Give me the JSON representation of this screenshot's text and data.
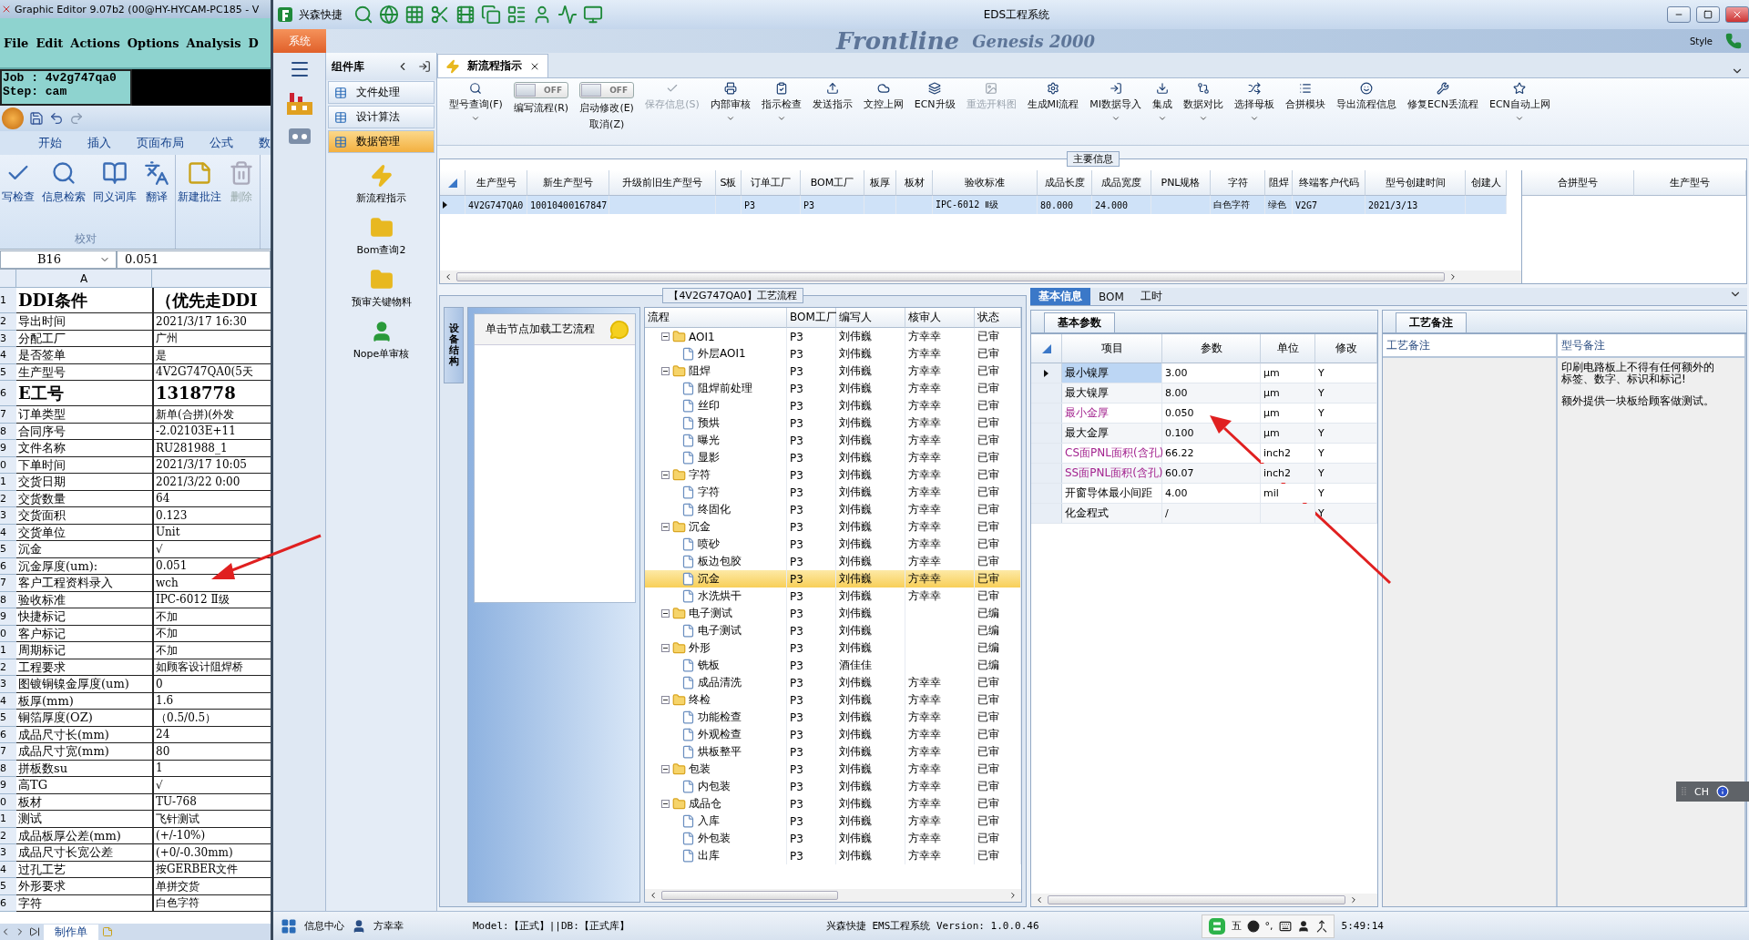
{
  "left_window": {
    "editor_title": "Graphic Editor 9.07b2 (00@HY-HYCAM-PC185 - V",
    "menu": [
      "File",
      "Edit",
      "Actions",
      "Options",
      "Analysis",
      "D"
    ],
    "job": "Job : 4v2g747qa0",
    "step": "Step: cam",
    "ribbon_tabs": [
      "开始",
      "插入",
      "页面布局",
      "公式",
      "数"
    ],
    "ribbon_buttons": [
      {
        "label": "写检查",
        "disabled": false
      },
      {
        "label": "信息检索",
        "disabled": false
      },
      {
        "label": "同义词库",
        "disabled": false
      },
      {
        "label": "翻译",
        "disabled": false
      },
      {
        "label": "新建批注",
        "disabled": false
      },
      {
        "label": "删除",
        "disabled": true
      }
    ],
    "ribbon_group": "校对",
    "name_box": "B16",
    "formula": "0.051",
    "column_a": "A",
    "rows": [
      {
        "num": "1",
        "a": "DDI条件",
        "b": "（优先走DDI",
        "kind": "heading"
      },
      {
        "num": "2",
        "a": "导出时间",
        "b": "2021/3/17 16:30",
        "kind": "normal"
      },
      {
        "num": "3",
        "a": "分配工厂",
        "b": "广州",
        "kind": "normal"
      },
      {
        "num": "4",
        "a": "是否签单",
        "b": "是",
        "kind": "normal"
      },
      {
        "num": "5",
        "a": "生产型号",
        "b": "4V2G747QA0(5天",
        "kind": "normal"
      },
      {
        "num": "6",
        "a": "E工号",
        "b": "1318778",
        "kind": "heading"
      },
      {
        "num": "7",
        "a": "订单类型",
        "b": "新单(合拼)(外发",
        "kind": "normal"
      },
      {
        "num": "8",
        "a": "合同序号",
        "b": "-2.02103E+11",
        "kind": "normal"
      },
      {
        "num": "9",
        "a": "文件名称",
        "b": "RU281988_1",
        "kind": "normal"
      },
      {
        "num": "0",
        "a": "下单时间",
        "b": "2021/3/17 10:05",
        "kind": "normal"
      },
      {
        "num": "1",
        "a": "交货日期",
        "b": "2021/3/22 0:00",
        "kind": "normal"
      },
      {
        "num": "2",
        "a": "交货数量",
        "b": "64",
        "kind": "normal"
      },
      {
        "num": "3",
        "a": "交货面积",
        "b": "0.123",
        "kind": "normal"
      },
      {
        "num": "4",
        "a": "交货单位",
        "b": "Unit",
        "kind": "normal"
      },
      {
        "num": "5",
        "a": "沉金",
        "b": "√",
        "kind": "normal"
      },
      {
        "num": "6",
        "a": "沉金厚度(um):",
        "b": "0.051",
        "kind": "normal"
      },
      {
        "num": "7",
        "a": "客户工程资料录入",
        "b": "wch",
        "kind": "normal"
      },
      {
        "num": "8",
        "a": "验收标准",
        "b": "IPC-6012 Ⅱ级",
        "kind": "normal"
      },
      {
        "num": "9",
        "a": "快捷标记",
        "b": "不加",
        "kind": "normal"
      },
      {
        "num": "0",
        "a": "客户标记",
        "b": "不加",
        "kind": "normal"
      },
      {
        "num": "1",
        "a": "周期标记",
        "b": "不加",
        "kind": "normal"
      },
      {
        "num": "2",
        "a": "工程要求",
        "b": "如顾客设计阻焊桥",
        "kind": "normal"
      },
      {
        "num": "3",
        "a": "图镀铜镍金厚度(um)",
        "b": "0",
        "kind": "normal"
      },
      {
        "num": "4",
        "a": "板厚(mm)",
        "b": "1.6",
        "kind": "normal"
      },
      {
        "num": "5",
        "a": "铜箔厚度(OZ)",
        "b": "（0.5/0.5）",
        "kind": "normal"
      },
      {
        "num": "6",
        "a": "成品尺寸长(mm)",
        "b": "24",
        "kind": "normal"
      },
      {
        "num": "7",
        "a": "成品尺寸宽(mm)",
        "b": "80",
        "kind": "normal"
      },
      {
        "num": "8",
        "a": "拼板数su",
        "b": "1",
        "kind": "normal"
      },
      {
        "num": "9",
        "a": "高TG",
        "b": "√",
        "kind": "normal"
      },
      {
        "num": "0",
        "a": "板材",
        "b": "TU-768",
        "kind": "normal"
      },
      {
        "num": "1",
        "a": "测试",
        "b": "飞针测试",
        "kind": "normal"
      },
      {
        "num": "2",
        "a": "成品板厚公差(mm)",
        "b": "(+/-10%)",
        "kind": "normal"
      },
      {
        "num": "3",
        "a": "成品尺寸长宽公差",
        "b": "(+0/-0.30mm)",
        "kind": "normal"
      },
      {
        "num": "4",
        "a": "过孔工艺",
        "b": "按GERBER文件",
        "kind": "normal"
      },
      {
        "num": "5",
        "a": "外形要求",
        "b": "单拼交货",
        "kind": "normal"
      },
      {
        "num": "6",
        "a": "字符",
        "b": "白色字符",
        "kind": "normal"
      }
    ],
    "sheet_tab": "制作单"
  },
  "main_window": {
    "brand": "兴森快捷",
    "title": "EDS工程系统",
    "system_tab": "系统",
    "banner": {
      "product": "Frontline",
      "version": "Genesis 2000",
      "style": "Style"
    },
    "library": {
      "title": "组件库",
      "items": [
        {
          "label": "文件处理",
          "selected": false
        },
        {
          "label": "设计算法",
          "selected": false
        },
        {
          "label": "数据管理",
          "selected": true
        }
      ],
      "tools": [
        "新流程指示",
        "Bom查询2",
        "预审关键物料",
        "Nope单审核"
      ]
    },
    "doc_tab": "新流程指示",
    "toolbar": [
      {
        "kind": "button",
        "label": "型号查询(F)",
        "dropdown": true,
        "disabled": false
      },
      {
        "kind": "toggle",
        "label": "编写流程(R)",
        "state_label": "OFF",
        "on": false
      },
      {
        "kind": "toggle",
        "label": "启动修改(E)",
        "sublabel": "取消(Z)",
        "state_label": "OFF",
        "on": false
      },
      {
        "kind": "button",
        "label": "保存信息(S)",
        "dropdown": false,
        "disabled": true
      },
      {
        "kind": "button",
        "label": "内部审核",
        "dropdown": true,
        "disabled": false
      },
      {
        "kind": "button",
        "label": "指示检查",
        "dropdown": true,
        "disabled": false
      },
      {
        "kind": "button",
        "label": "发送指示",
        "dropdown": false,
        "disabled": false
      },
      {
        "kind": "button",
        "label": "文控上网",
        "dropdown": false,
        "disabled": false
      },
      {
        "kind": "button",
        "label": "ECN升级",
        "dropdown": false,
        "disabled": false
      },
      {
        "kind": "button",
        "label": "重选开料图",
        "dropdown": false,
        "disabled": true
      },
      {
        "kind": "button",
        "label": "生成MI流程",
        "dropdown": false,
        "disabled": false
      },
      {
        "kind": "button",
        "label": "MI数据导入",
        "dropdown": true,
        "disabled": false
      },
      {
        "kind": "button",
        "label": "集成",
        "dropdown": true,
        "disabled": false
      },
      {
        "kind": "button",
        "label": "数据对比",
        "dropdown": true,
        "disabled": false
      },
      {
        "kind": "button",
        "label": "选择母板",
        "dropdown": true,
        "disabled": false
      },
      {
        "kind": "button",
        "label": "合拼模块",
        "dropdown": false,
        "disabled": false
      },
      {
        "kind": "button",
        "label": "导出流程信息",
        "dropdown": false,
        "disabled": false
      },
      {
        "kind": "button",
        "label": "修复ECN丢流程",
        "dropdown": false,
        "disabled": false
      },
      {
        "kind": "button",
        "label": "ECN自动上网",
        "dropdown": true,
        "disabled": false
      }
    ],
    "main_info": {
      "title": "主要信息",
      "columns": [
        "生产型号",
        "新生产型号",
        "升级前旧生产型号",
        "S板",
        "订单工厂",
        "BOM工厂",
        "板厚",
        "板材",
        "验收标准",
        "成品长度",
        "成品宽度",
        "PNL规格",
        "字符",
        "阻焊",
        "终端客户代码",
        "型号创建时间",
        "创建人"
      ],
      "rows": [
        {
          "selected": true,
          "cells": [
            "4V2G747QA0",
            "10010400167847",
            null,
            null,
            "P3",
            "P3",
            null,
            null,
            "IPC-6012 Ⅱ级",
            "80.000",
            "24.000",
            null,
            "白色字符",
            "绿色",
            "V2G7",
            "2021/3/13",
            null
          ]
        }
      ],
      "side_columns": [
        "合拼型号",
        "生产型号"
      ]
    },
    "flow": {
      "title": "【4V2G747QA0】工艺流程",
      "side_tab": "设备结构",
      "hint": "单击节点加载工艺流程",
      "columns": [
        "流程",
        "BOM工厂",
        "编写人",
        "核审人",
        "状态"
      ],
      "tree": [
        {
          "name": "AOI1",
          "bom": "P3",
          "writer": "刘伟巍",
          "reviewer": "方幸幸",
          "status": "已审",
          "expanded": true,
          "selected": false,
          "children": [
            {
              "name": "外层AOI1",
              "bom": "P3",
              "writer": "刘伟巍",
              "reviewer": "方幸幸",
              "status": "已审",
              "selected": false
            }
          ]
        },
        {
          "name": "阻焊",
          "bom": "P3",
          "writer": "刘伟巍",
          "reviewer": "方幸幸",
          "status": "已审",
          "expanded": true,
          "selected": false,
          "children": [
            {
              "name": "阻焊前处理",
              "bom": "P3",
              "writer": "刘伟巍",
              "reviewer": "方幸幸",
              "status": "已审",
              "selected": false
            },
            {
              "name": "丝印",
              "bom": "P3",
              "writer": "刘伟巍",
              "reviewer": "方幸幸",
              "status": "已审",
              "selected": false
            },
            {
              "name": "预烘",
              "bom": "P3",
              "writer": "刘伟巍",
              "reviewer": "方幸幸",
              "status": "已审",
              "selected": false
            },
            {
              "name": "曝光",
              "bom": "P3",
              "writer": "刘伟巍",
              "reviewer": "方幸幸",
              "status": "已审",
              "selected": false
            },
            {
              "name": "显影",
              "bom": "P3",
              "writer": "刘伟巍",
              "reviewer": "方幸幸",
              "status": "已审",
              "selected": false
            }
          ]
        },
        {
          "name": "字符",
          "bom": "P3",
          "writer": "刘伟巍",
          "reviewer": "方幸幸",
          "status": "已审",
          "expanded": true,
          "selected": false,
          "children": [
            {
              "name": "字符",
              "bom": "P3",
              "writer": "刘伟巍",
              "reviewer": "方幸幸",
              "status": "已审",
              "selected": false
            },
            {
              "name": "终固化",
              "bom": "P3",
              "writer": "刘伟巍",
              "reviewer": "方幸幸",
              "status": "已审",
              "selected": false
            }
          ]
        },
        {
          "name": "沉金",
          "bom": "P3",
          "writer": "刘伟巍",
          "reviewer": "方幸幸",
          "status": "已审",
          "expanded": true,
          "selected": false,
          "children": [
            {
              "name": "喷砂",
              "bom": "P3",
              "writer": "刘伟巍",
              "reviewer": "方幸幸",
              "status": "已审",
              "selected": false
            },
            {
              "name": "板边包胶",
              "bom": "P3",
              "writer": "刘伟巍",
              "reviewer": "方幸幸",
              "status": "已审",
              "selected": false
            },
            {
              "name": "沉金",
              "bom": "P3",
              "writer": "刘伟巍",
              "reviewer": "方幸幸",
              "status": "已审",
              "selected": true
            },
            {
              "name": "水洗烘干",
              "bom": "P3",
              "writer": "刘伟巍",
              "reviewer": "方幸幸",
              "status": "已审",
              "selected": false
            }
          ]
        },
        {
          "name": "电子测试",
          "bom": "P3",
          "writer": "刘伟巍",
          "status": "已编",
          "expanded": true,
          "selected": false,
          "children": [
            {
              "name": "电子测试",
              "bom": "P3",
              "writer": "刘伟巍",
              "status": "已编",
              "selected": false
            }
          ]
        },
        {
          "name": "外形",
          "bom": "P3",
          "writer": "刘伟巍",
          "status": "已编",
          "expanded": true,
          "selected": false,
          "children": [
            {
              "name": "铣板",
              "bom": "P3",
              "writer": "酒佳佳",
              "status": "已编",
              "selected": false
            },
            {
              "name": "成品清洗",
              "bom": "P3",
              "writer": "刘伟巍",
              "reviewer": "方幸幸",
              "status": "已审",
              "selected": false
            }
          ]
        },
        {
          "name": "终检",
          "bom": "P3",
          "writer": "刘伟巍",
          "reviewer": "方幸幸",
          "status": "已审",
          "expanded": true,
          "selected": false,
          "children": [
            {
              "name": "功能检查",
              "bom": "P3",
              "writer": "刘伟巍",
              "reviewer": "方幸幸",
              "status": "已审",
              "selected": false
            },
            {
              "name": "外观检查",
              "bom": "P3",
              "writer": "刘伟巍",
              "reviewer": "方幸幸",
              "status": "已审",
              "selected": false
            },
            {
              "name": "烘板整平",
              "bom": "P3",
              "writer": "刘伟巍",
              "reviewer": "方幸幸",
              "status": "已审",
              "selected": false
            }
          ]
        },
        {
          "name": "包装",
          "bom": "P3",
          "writer": "刘伟巍",
          "reviewer": "方幸幸",
          "status": "已审",
          "expanded": true,
          "selected": false,
          "children": [
            {
              "name": "内包装",
              "bom": "P3",
              "writer": "刘伟巍",
              "reviewer": "方幸幸",
              "status": "已审",
              "selected": false
            }
          ]
        },
        {
          "name": "成品仓",
          "bom": "P3",
          "writer": "刘伟巍",
          "reviewer": "方幸幸",
          "status": "已审",
          "expanded": true,
          "selected": false,
          "children": [
            {
              "name": "入库",
              "bom": "P3",
              "writer": "刘伟巍",
              "reviewer": "方幸幸",
              "status": "已审",
              "selected": false
            },
            {
              "name": "外包装",
              "bom": "P3",
              "writer": "刘伟巍",
              "reviewer": "方幸幸",
              "status": "已审",
              "selected": false
            },
            {
              "name": "出库",
              "bom": "P3",
              "writer": "刘伟巍",
              "reviewer": "方幸幸",
              "status": "已审",
              "selected": false
            }
          ]
        }
      ]
    },
    "detail_tabs": [
      {
        "label": "基本信息",
        "selected": true
      },
      {
        "label": "BOM",
        "selected": false
      },
      {
        "label": "工时",
        "selected": false
      }
    ],
    "params": {
      "title": "基本参数",
      "columns": [
        "项目",
        "参数",
        "单位",
        "修改"
      ],
      "rows": [
        {
          "item": "最小镍厚",
          "value": "3.00",
          "unit": "μm",
          "edit": "Y",
          "selected": true,
          "highlighted": false
        },
        {
          "item": "最大镍厚",
          "value": "8.00",
          "unit": "μm",
          "edit": "Y",
          "selected": false,
          "highlighted": false
        },
        {
          "item": "最小金厚",
          "value": "0.050",
          "unit": "μm",
          "edit": "Y",
          "selected": false,
          "highlighted": true
        },
        {
          "item": "最大金厚",
          "value": "0.100",
          "unit": "μm",
          "edit": "Y",
          "selected": false,
          "highlighted": false
        },
        {
          "item": "CS面PNL面积(含孔)",
          "value": "66.22",
          "unit": "inch2",
          "edit": "Y",
          "selected": false,
          "highlighted": true
        },
        {
          "item": "SS面PNL面积(含孔)",
          "value": "60.07",
          "unit": "inch2",
          "edit": "Y",
          "selected": false,
          "highlighted": true
        },
        {
          "item": "开窗导体最小间距",
          "value": "4.00",
          "unit": "mil",
          "edit": "Y",
          "selected": false,
          "highlighted": false
        },
        {
          "item": "化金程式",
          "value": "/",
          "edit": "Y",
          "selected": false,
          "highlighted": false
        }
      ]
    },
    "notes": {
      "title": "工艺备注",
      "columns": [
        "工艺备注",
        "型号备注"
      ],
      "model_notes": [
        "印刷电路板上不得有任何额外的标签、数字、标识和标记!",
        "额外提供一块板给顾客做测试。"
      ]
    },
    "ime_bar": "CH",
    "status": {
      "info": "信息中心",
      "user": "方幸幸",
      "model": "Model:【正式】||DB:【正式库】",
      "version": "兴森快捷 EMS工程系统 Version: 1.0.0.46",
      "ime_mode": "五",
      "ime_punct": "°,",
      "clock": "5:49:14"
    }
  }
}
